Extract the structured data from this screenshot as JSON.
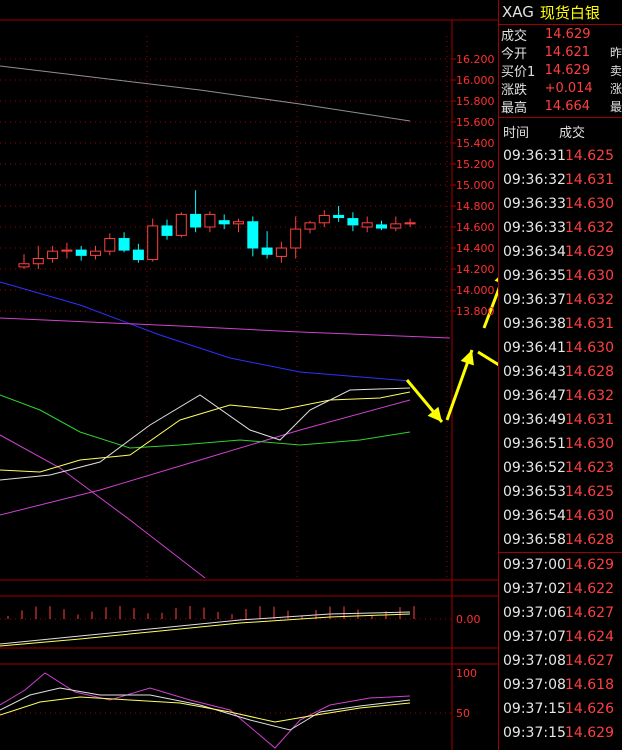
{
  "quote": {
    "symbol": "XAG",
    "name": "现货白银",
    "rows": [
      {
        "label": "成交",
        "value": "14.629",
        "cut": ""
      },
      {
        "label": "今开",
        "value": "14.621",
        "cut": "昨"
      },
      {
        "label": "买价1",
        "value": "14.629",
        "cut": "卖"
      },
      {
        "label": "涨跌",
        "value": "+0.014",
        "cut": "涨"
      },
      {
        "label": "最高",
        "value": "14.664",
        "cut": "最"
      }
    ]
  },
  "trades": {
    "header_time": "时间",
    "header_price": "成交",
    "rows": [
      {
        "time": "09:36:31",
        "price": "14.625"
      },
      {
        "time": "09:36:32",
        "price": "14.631"
      },
      {
        "time": "09:36:33",
        "price": "14.630"
      },
      {
        "time": "09:36:33",
        "price": "14.632"
      },
      {
        "time": "09:36:34",
        "price": "14.629"
      },
      {
        "time": "09:36:35",
        "price": "14.630"
      },
      {
        "time": "09:36:37",
        "price": "14.632"
      },
      {
        "time": "09:36:38",
        "price": "14.631"
      },
      {
        "time": "09:36:41",
        "price": "14.630"
      },
      {
        "time": "09:36:43",
        "price": "14.628"
      },
      {
        "time": "09:36:47",
        "price": "14.632"
      },
      {
        "time": "09:36:49",
        "price": "14.631"
      },
      {
        "time": "09:36:51",
        "price": "14.630"
      },
      {
        "time": "09:36:52",
        "price": "14.623"
      },
      {
        "time": "09:36:53",
        "price": "14.625"
      },
      {
        "time": "09:36:54",
        "price": "14.630"
      },
      {
        "time": "09:36:58",
        "price": "14.628"
      },
      {
        "time": "09:37:00",
        "price": "14.629"
      },
      {
        "time": "09:37:02",
        "price": "14.622"
      },
      {
        "time": "09:37:06",
        "price": "14.627"
      },
      {
        "time": "09:37:07",
        "price": "14.624"
      },
      {
        "time": "09:37:08",
        "price": "14.627"
      },
      {
        "time": "09:37:08",
        "price": "14.618"
      },
      {
        "time": "09:37:15",
        "price": "14.626"
      },
      {
        "time": "09:37:15",
        "price": "14.629"
      }
    ]
  },
  "chart_data": {
    "type": "candlestick",
    "y_ticks": [
      "16.200",
      "16.000",
      "15.800",
      "15.600",
      "15.400",
      "15.200",
      "15.000",
      "14.800",
      "14.600",
      "14.400",
      "14.200",
      "14.000",
      "13.800"
    ],
    "ylim": [
      13.75,
      16.28
    ],
    "macd_ticks": [
      "0.00"
    ],
    "kdj_ticks": [
      "100",
      "50"
    ],
    "candles": [
      {
        "o": 14.22,
        "h": 14.34,
        "l": 14.2,
        "c": 14.25
      },
      {
        "o": 14.25,
        "h": 14.42,
        "l": 14.2,
        "c": 14.3
      },
      {
        "o": 14.3,
        "h": 14.42,
        "l": 14.26,
        "c": 14.37
      },
      {
        "o": 14.37,
        "h": 14.45,
        "l": 14.3,
        "c": 14.38
      },
      {
        "o": 14.38,
        "h": 14.42,
        "l": 14.28,
        "c": 14.33
      },
      {
        "o": 14.33,
        "h": 14.42,
        "l": 14.29,
        "c": 14.37
      },
      {
        "o": 14.37,
        "h": 14.54,
        "l": 14.33,
        "c": 14.49
      },
      {
        "o": 14.49,
        "h": 14.55,
        "l": 14.36,
        "c": 14.38
      },
      {
        "o": 14.38,
        "h": 14.44,
        "l": 14.26,
        "c": 14.29
      },
      {
        "o": 14.29,
        "h": 14.68,
        "l": 14.27,
        "c": 14.61
      },
      {
        "o": 14.61,
        "h": 14.67,
        "l": 14.48,
        "c": 14.52
      },
      {
        "o": 14.52,
        "h": 14.74,
        "l": 14.5,
        "c": 14.72
      },
      {
        "o": 14.72,
        "h": 14.95,
        "l": 14.55,
        "c": 14.6
      },
      {
        "o": 14.6,
        "h": 14.75,
        "l": 14.55,
        "c": 14.72
      },
      {
        "o": 14.66,
        "h": 14.72,
        "l": 14.58,
        "c": 14.63
      },
      {
        "o": 14.63,
        "h": 14.68,
        "l": 14.55,
        "c": 14.65
      },
      {
        "o": 14.65,
        "h": 14.7,
        "l": 14.32,
        "c": 14.4
      },
      {
        "o": 14.4,
        "h": 14.56,
        "l": 14.3,
        "c": 14.34
      },
      {
        "o": 14.32,
        "h": 14.46,
        "l": 14.26,
        "c": 14.4
      },
      {
        "o": 14.4,
        "h": 14.7,
        "l": 14.3,
        "c": 14.58
      },
      {
        "o": 14.58,
        "h": 14.66,
        "l": 14.54,
        "c": 14.64
      },
      {
        "o": 14.64,
        "h": 14.76,
        "l": 14.6,
        "c": 14.71
      },
      {
        "o": 14.71,
        "h": 14.8,
        "l": 14.65,
        "c": 14.69
      },
      {
        "o": 14.68,
        "h": 14.74,
        "l": 14.56,
        "c": 14.62
      },
      {
        "o": 14.6,
        "h": 14.7,
        "l": 14.55,
        "c": 14.64
      },
      {
        "o": 14.62,
        "h": 14.66,
        "l": 14.57,
        "c": 14.59
      },
      {
        "o": 14.59,
        "h": 14.7,
        "l": 14.56,
        "c": 14.63
      },
      {
        "o": 14.63,
        "h": 14.68,
        "l": 14.6,
        "c": 14.64
      }
    ]
  },
  "colors": {
    "up": "#ff4040",
    "down": "#00ffff",
    "grid": "#a00000",
    "arrow": "#ffff00",
    "ma_blue": "#3030ff",
    "ma_pink": "#d040d0",
    "ma_green": "#30d030",
    "ma_yellow": "#ffff60",
    "ma_white": "#e0e0e0",
    "ma_gray": "#909090"
  },
  "icons": [
    "arrow-icon"
  ]
}
